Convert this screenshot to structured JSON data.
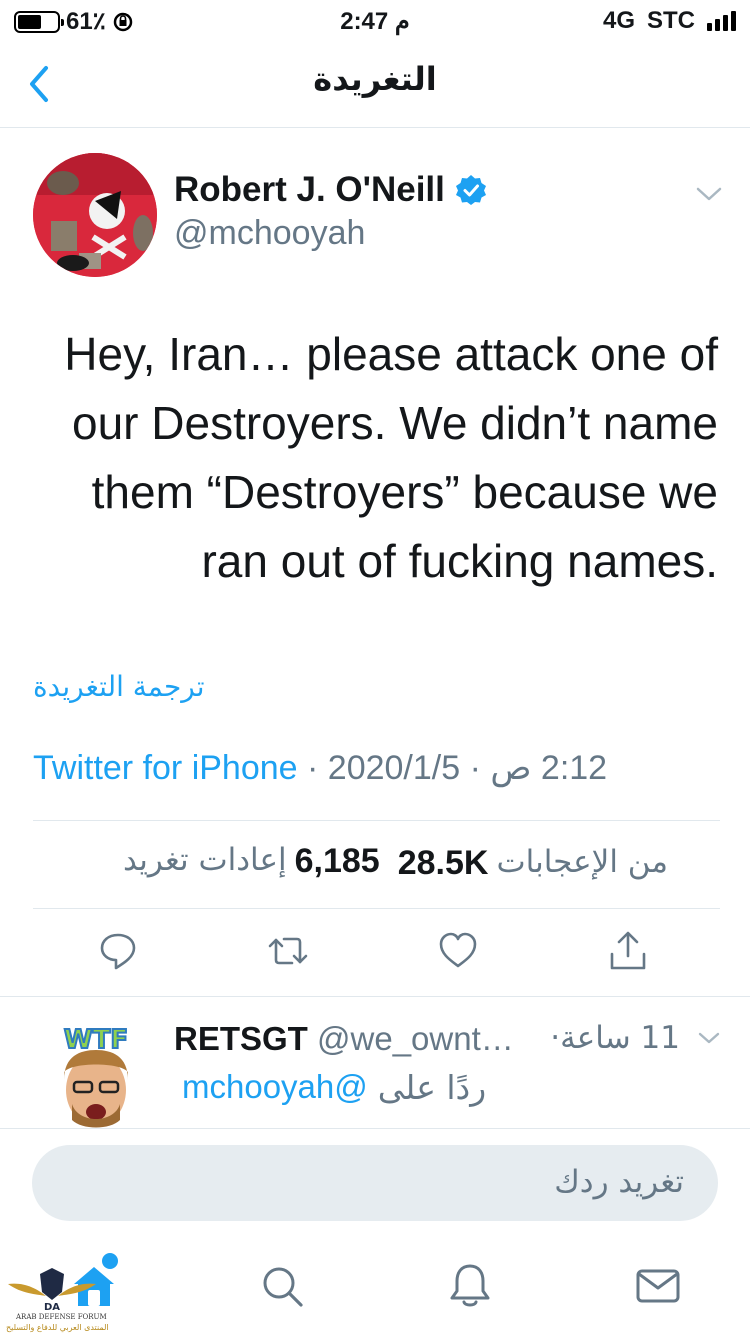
{
  "status_bar": {
    "battery": "61٪",
    "battery_level": 0.61,
    "time": "2:47 م",
    "network": "4G",
    "carrier": "STC"
  },
  "nav": {
    "back_icon": "chevron-left-icon",
    "title": "التغريدة"
  },
  "tweet": {
    "author_name": "Robert J. O'Neill",
    "author_handle": "@mchooyah",
    "verified": true,
    "text_lines": [
      "Hey, Iran… please attack one of",
      "our Destroyers. We didn’t name",
      "them “Destroyers” because we",
      "ran out of fucking names."
    ],
    "translate_label": "ترجمة التغريدة",
    "source": "Twitter for iPhone",
    "separator": " · ",
    "date": "2020/1/5",
    "time": "2:12 ص",
    "retweets_count": "6,185",
    "retweets_label": "إعادات تغريد",
    "likes_count": "28.5K",
    "likes_label": "من الإعجابات"
  },
  "actions": [
    "reply-icon",
    "retweet-icon",
    "like-icon",
    "share-icon"
  ],
  "reply": {
    "name": "RETSGT",
    "handle": "@we_ownt…",
    "dot": "·",
    "time": "11 ساعة",
    "replying_prefix": "ردًا على",
    "replying_to": "@mchooyah"
  },
  "composer": {
    "placeholder": "تغريد ردك"
  },
  "tab_bar": [
    "home-icon",
    "search-icon",
    "notifications-icon",
    "messages-icon"
  ],
  "watermark": {
    "line1": "ARAB DEFENSE FORUM",
    "line2": "المنتدى العربي للدفاع والتسليح"
  },
  "colors": {
    "accent": "#1da1f2",
    "secondary_text": "#657786",
    "primary_text": "#14171a",
    "divider": "#e1e8ed"
  }
}
